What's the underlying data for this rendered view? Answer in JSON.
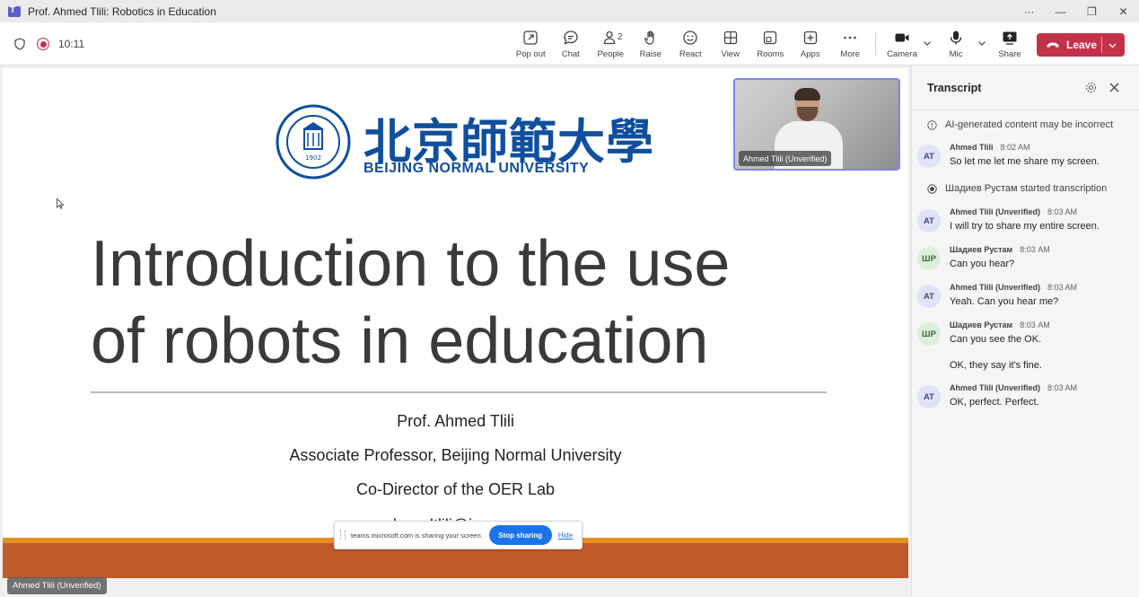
{
  "window": {
    "title": "Prof. Ahmed Tlili: Robotics in Education"
  },
  "meeting": {
    "timer": "10:11",
    "toolbar": [
      {
        "id": "popout",
        "label": "Pop out",
        "icon": "pop-out-icon"
      },
      {
        "id": "chat",
        "label": "Chat",
        "icon": "chat-icon"
      },
      {
        "id": "people",
        "label": "People",
        "icon": "people-icon",
        "badge": "2"
      },
      {
        "id": "raise",
        "label": "Raise",
        "icon": "raise-hand-icon"
      },
      {
        "id": "react",
        "label": "React",
        "icon": "react-smiley-icon"
      },
      {
        "id": "view",
        "label": "View",
        "icon": "view-grid-icon"
      },
      {
        "id": "rooms",
        "label": "Rooms",
        "icon": "rooms-icon"
      },
      {
        "id": "apps",
        "label": "Apps",
        "icon": "apps-plus-icon"
      },
      {
        "id": "more",
        "label": "More",
        "icon": "more-icon"
      }
    ],
    "devices": {
      "camera_label": "Camera",
      "mic_label": "Mic",
      "share_label": "Share"
    },
    "leave_label": "Leave",
    "accent": "#c4314b"
  },
  "slide": {
    "university_cn": "北京師範大學",
    "university_en": "BEIJING NORMAL UNIVERSITY",
    "seal_year": "1902",
    "title_line1": "Introduction to the use",
    "title_line2": "of robots in education",
    "presenter": "Prof. Ahmed Tlili",
    "position": "Associate Professor, Beijing Normal University",
    "role": "Co-Director of the OER Lab",
    "email_partial": "ahmedtlili@ieee.org",
    "band_color": "#bf5a2a"
  },
  "share_bar": {
    "message": "teams.microsoft.com is sharing your screen.",
    "stop_label": "Stop sharing",
    "hide_label": "Hide"
  },
  "stage": {
    "presenter_tag": "Ahmed Tlili (Unverified)",
    "video_name": "Ahmed Tlili (Unverified)"
  },
  "transcript": {
    "title": "Transcript",
    "notice": "AI-generated content may be incorrect",
    "started": "Шадиев Рустам started transcription",
    "entries": [
      {
        "initials": "AT",
        "speaker": "Ahmed Tlili",
        "time": "8:02 AM",
        "text": "So let me let me share my screen."
      },
      {
        "initials": "AT",
        "speaker": "Ahmed Tlili (Unverified)",
        "time": "8:03 AM",
        "text": "I will try to share my entire screen."
      },
      {
        "initials": "ШР",
        "speaker": "Шадиев Рустам",
        "time": "8:03 AM",
        "text": "Can you hear?"
      },
      {
        "initials": "AT",
        "speaker": "Ahmed Tlili (Unverified)",
        "time": "8:03 AM",
        "text": "Yeah. Can you hear me?"
      },
      {
        "initials": "ШР",
        "speaker": "Шадиев Рустам",
        "time": "8:03 AM",
        "text": "Can you see the OK.",
        "extra": "OK, they say it's fine."
      },
      {
        "initials": "AT",
        "speaker": "Ahmed Tlili (Unverified)",
        "time": "8:03 AM",
        "text": "OK, perfect. Perfect."
      }
    ]
  }
}
